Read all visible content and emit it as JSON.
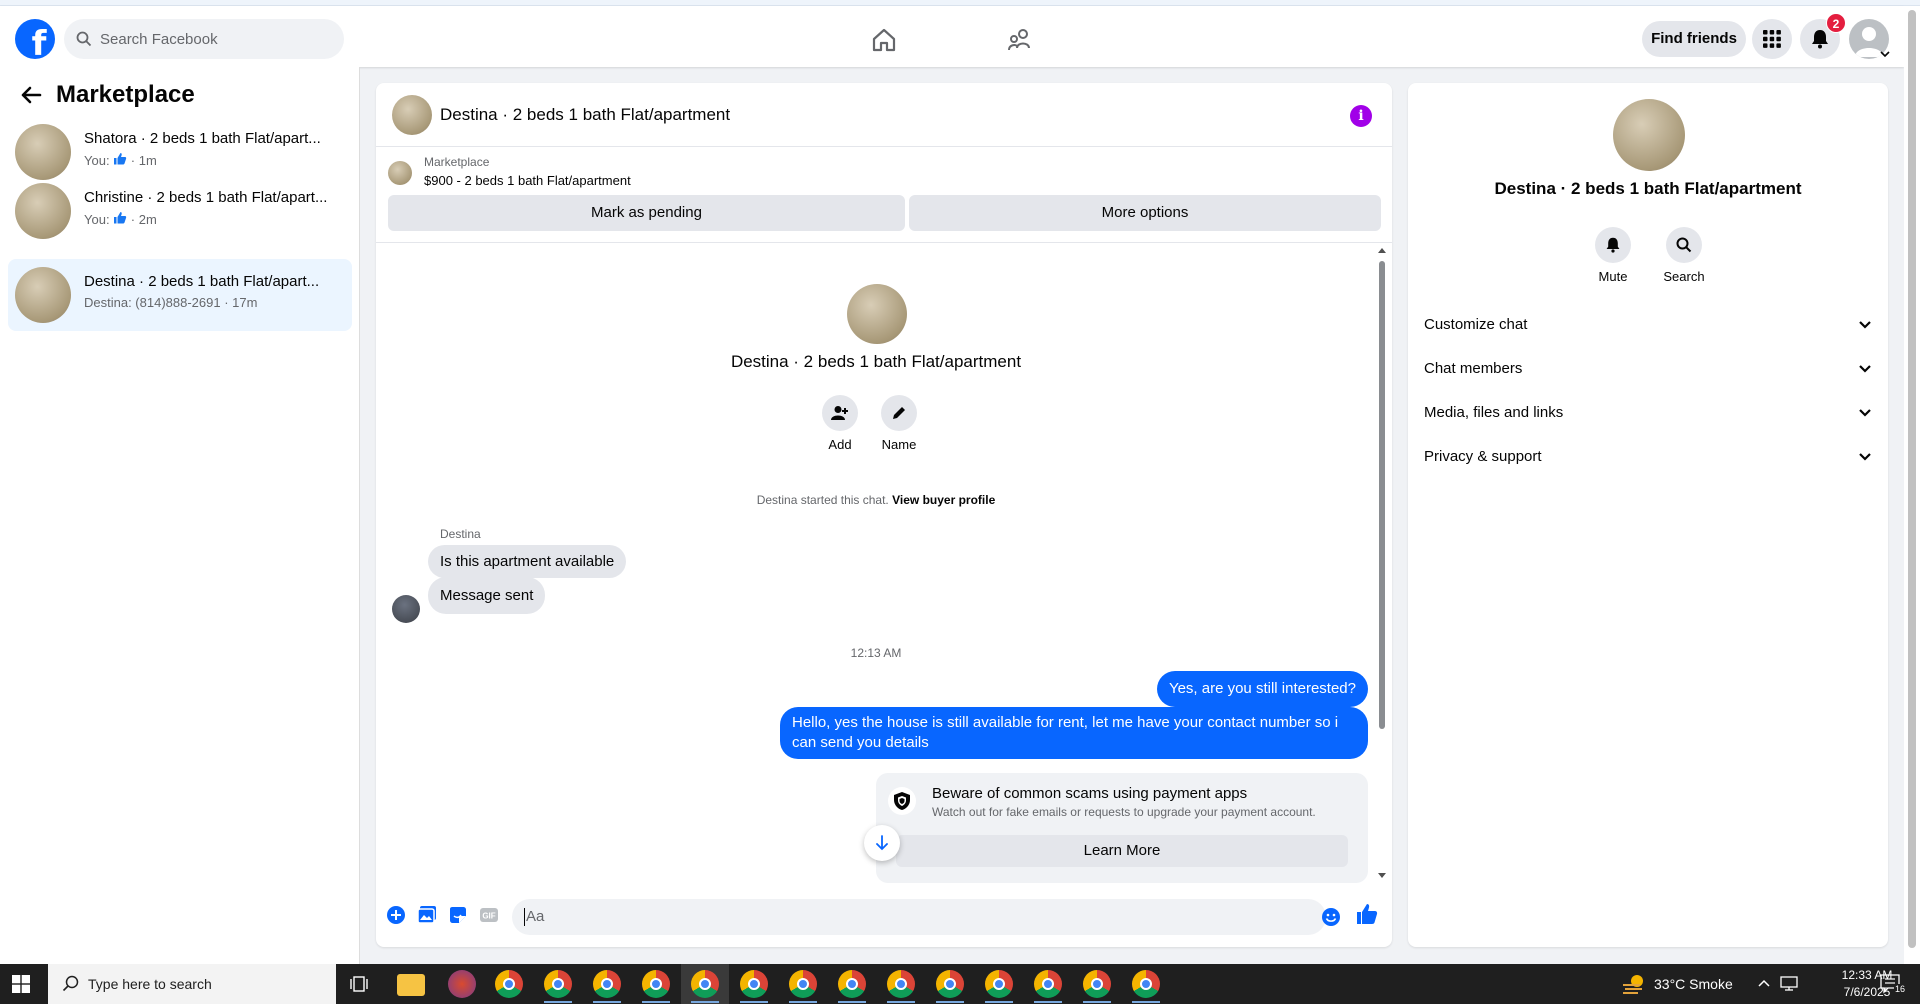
{
  "topbar": {
    "logo_letter": "f",
    "search_placeholder": "Search Facebook",
    "find_friends_label": "Find friends",
    "notification_count": "2"
  },
  "left_panel": {
    "title": "Marketplace",
    "threads": [
      {
        "name": "Shatora · 2 beds 1 bath Flat/apart...",
        "prefix": "You:",
        "suffix": " · 1m",
        "liked": true,
        "active": false
      },
      {
        "name": "Christine · 2 beds 1 bath Flat/apart...",
        "prefix": "You:",
        "suffix": " · 2m",
        "liked": true,
        "active": false
      },
      {
        "name": "Destina · 2 beds 1 bath Flat/apart...",
        "prefix": "Destina: (814)888-2691",
        "suffix": " · 17m",
        "liked": false,
        "active": true
      }
    ]
  },
  "chat": {
    "header_name": "Destina · 2 beds 1 bath Flat/apartment",
    "info_glyph": "i",
    "marketplace_label": "Marketplace",
    "listing_price_title": "$900 - 2 beds 1 bath Flat/apartment",
    "mark_pending_label": "Mark as pending",
    "more_options_label": "More options",
    "intro_name": "Destina · 2 beds 1 bath Flat/apartment",
    "add_label": "Add",
    "name_label": "Name",
    "started_text": "Destina started this chat.",
    "view_buyer_profile": "View buyer profile",
    "sender_name": "Destina",
    "incoming": [
      "Is this apartment available",
      "Message sent"
    ],
    "timestamp": "12:13 AM",
    "outgoing": [
      "Yes, are you still interested?",
      "Hello, yes the house is still available for rent, let me have your contact number so i can send you details"
    ],
    "scam_title": "Beware of common scams using payment apps",
    "scam_subtitle": "Watch out for fake emails or requests to upgrade your payment account.",
    "learn_more_label": "Learn More",
    "composer_placeholder": "Aa"
  },
  "right_panel": {
    "name": "Destina · 2 beds 1 bath Flat/apartment",
    "mute_label": "Mute",
    "search_label": "Search",
    "sections": [
      "Customize chat",
      "Chat members",
      "Media, files and links",
      "Privacy & support"
    ]
  },
  "taskbar": {
    "search_placeholder": "Type here to search",
    "weather": "33°C  Smoke",
    "time": "12:33 AM",
    "date": "7/6/2025",
    "notif_count": "16"
  },
  "colors": {
    "accent": "#0866ff",
    "badge": "#e41e3f",
    "info": "#a100e8"
  }
}
